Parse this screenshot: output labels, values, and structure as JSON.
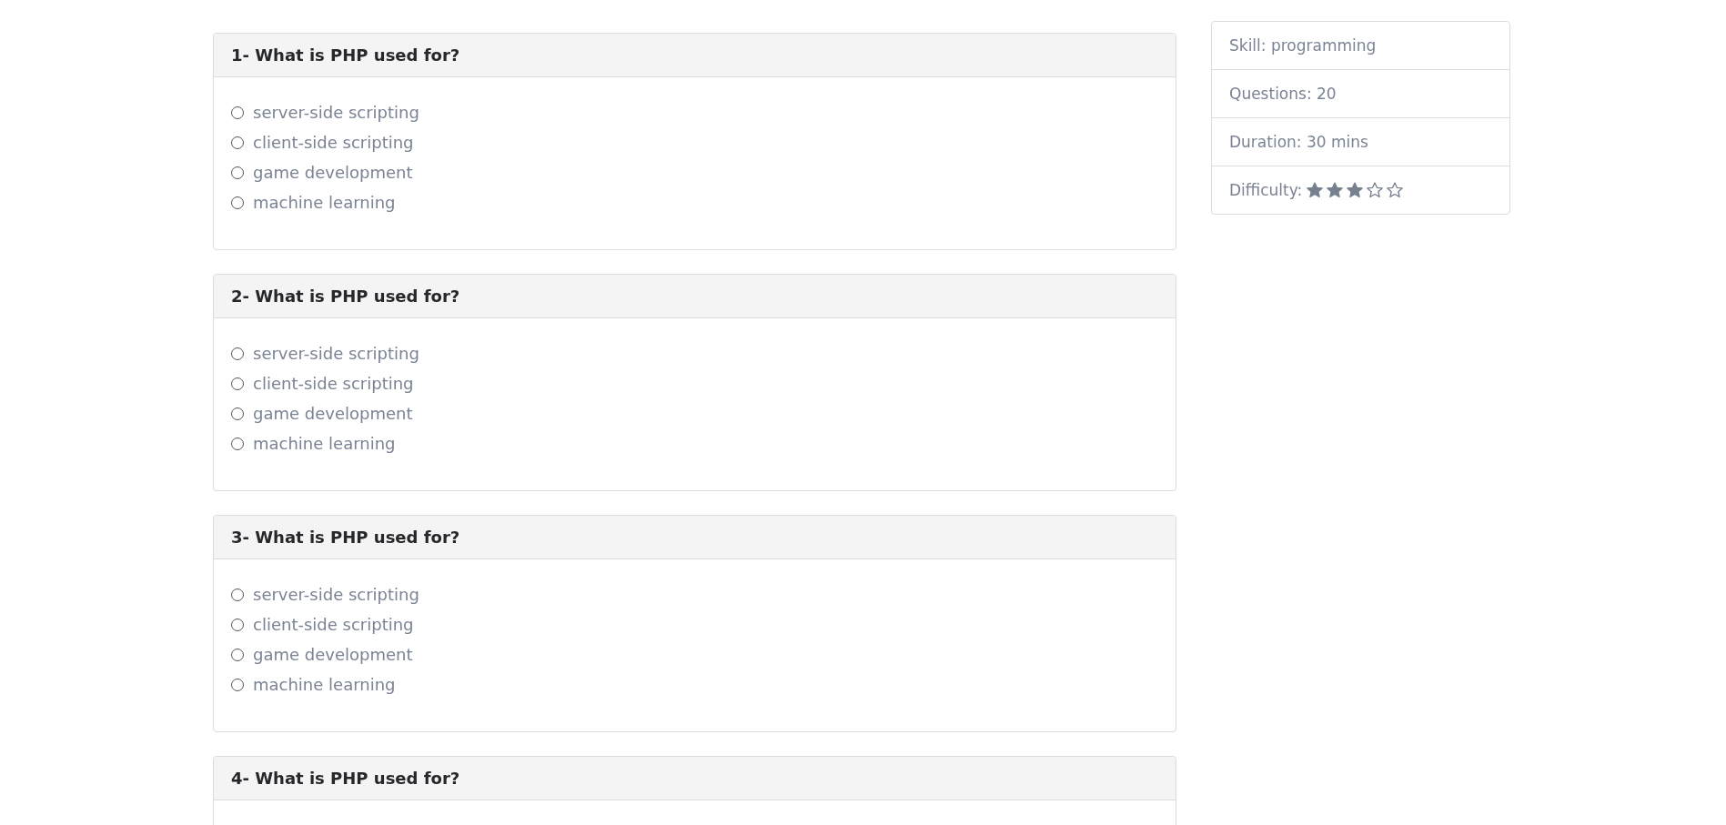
{
  "questions": [
    {
      "title": "1- What is PHP used for?",
      "options": [
        {
          "label": "server-side scripting",
          "selected": false
        },
        {
          "label": "client-side scripting",
          "selected": false
        },
        {
          "label": "game development",
          "selected": false
        },
        {
          "label": "machine learning",
          "selected": false
        }
      ]
    },
    {
      "title": "2- What is PHP used for?",
      "options": [
        {
          "label": "server-side scripting",
          "selected": false
        },
        {
          "label": "client-side scripting",
          "selected": false
        },
        {
          "label": "game development",
          "selected": false
        },
        {
          "label": "machine learning",
          "selected": false
        }
      ]
    },
    {
      "title": "3- What is PHP used for?",
      "options": [
        {
          "label": "server-side scripting",
          "selected": false
        },
        {
          "label": "client-side scripting",
          "selected": false
        },
        {
          "label": "game development",
          "selected": false
        },
        {
          "label": "machine learning",
          "selected": false
        }
      ]
    },
    {
      "title": "4- What is PHP used for?"
    }
  ],
  "quiz_info": [
    {
      "kind": "text",
      "label": "Skill: programming"
    },
    {
      "kind": "text",
      "label": "Questions: 20"
    },
    {
      "kind": "text",
      "label": "Duration: 30 mins"
    },
    {
      "kind": "rating",
      "label": "Difficulty:",
      "stars": 3
    }
  ]
}
